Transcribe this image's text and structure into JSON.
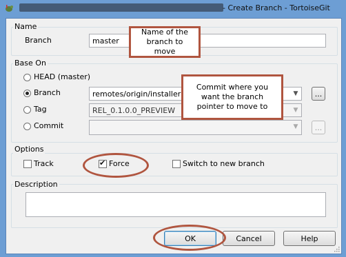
{
  "window": {
    "title": "- Create Branch - TortoiseGit"
  },
  "name_group": {
    "label": "Name",
    "branch_label": "Branch",
    "branch_value": "master"
  },
  "base_on_group": {
    "label": "Base On",
    "head_label": "HEAD (master)",
    "branch_label": "Branch",
    "branch_value": "remotes/origin/installer",
    "tag_label": "Tag",
    "tag_value": "REL_0.1.0.0_PREVIEW",
    "commit_label": "Commit",
    "commit_value": "",
    "browse_label": "..."
  },
  "options_group": {
    "label": "Options",
    "track_label": "Track",
    "force_label": "Force",
    "switch_label": "Switch to new branch"
  },
  "description_group": {
    "label": "Description",
    "value": ""
  },
  "buttons": {
    "ok": "OK",
    "cancel": "Cancel",
    "help": "Help"
  },
  "annotations": {
    "callout_name": "Name of the branch to move",
    "callout_commit": "Commit where you want the branch pointer to move to"
  },
  "colors": {
    "annotation": "#b0553f",
    "titlebar": "#6d9ed4"
  }
}
